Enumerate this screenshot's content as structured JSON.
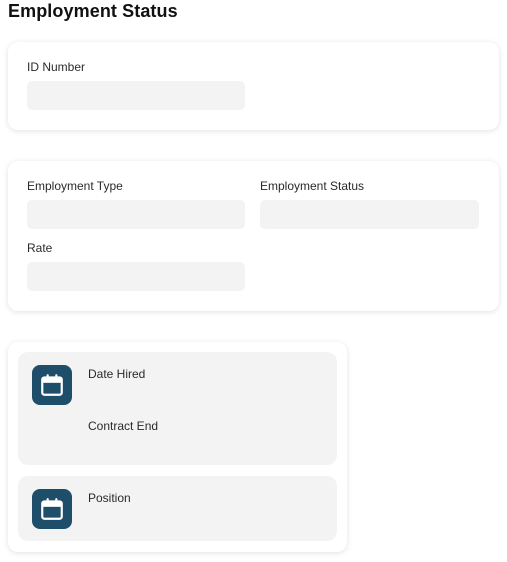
{
  "page": {
    "title": "Employment Status"
  },
  "identification": {
    "id_number_label": "ID Number",
    "id_number_value": ""
  },
  "employment": {
    "type_label": "Employment Type",
    "type_value": "",
    "status_label": "Employment Status",
    "status_value": "",
    "rate_label": "Rate",
    "rate_value": ""
  },
  "dates": {
    "date_hired_label": "Date Hired",
    "contract_end_label": "Contract End",
    "position_label": "Position",
    "icon": "calendar-icon"
  },
  "colors": {
    "accent": "#1f4e6b",
    "field_background": "#f3f3f3",
    "card_background": "#ffffff"
  }
}
